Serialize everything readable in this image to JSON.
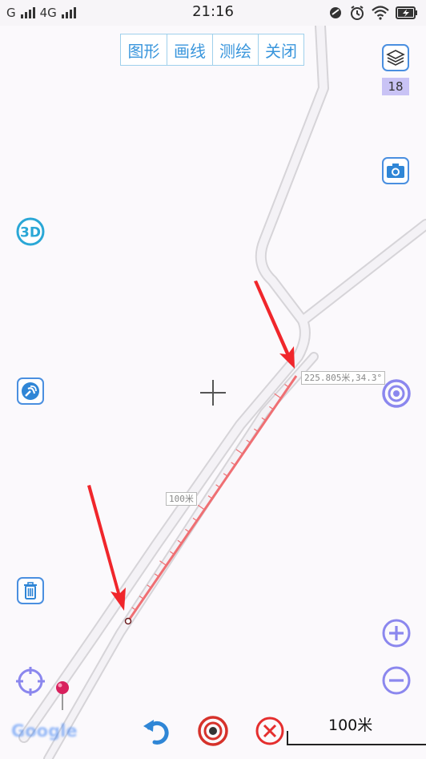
{
  "status_bar": {
    "carrier1": "G",
    "carrier2": "4G",
    "time": "21:16",
    "icons": [
      "dnd-icon",
      "alarm-icon",
      "wifi-icon",
      "battery-charging-icon"
    ]
  },
  "toolbar": {
    "items": [
      "图形",
      "画线",
      "测绘",
      "关闭"
    ]
  },
  "right_panel": {
    "layers_icon": "layers-icon",
    "zoom_level": "18",
    "camera_icon": "camera-icon",
    "locate_target_icon": "target-icon",
    "zoom_in_icon": "zoom-in-icon",
    "zoom_out_icon": "zoom-out-icon"
  },
  "left_panel": {
    "threed_label": "3D",
    "satellite_icon": "satellite-icon",
    "trash_icon": "trash-icon",
    "gps_icon": "gps-crosshair-icon"
  },
  "measurement": {
    "end_label": "225.805米,34.3°",
    "mid_label": "100米"
  },
  "bottom_bar": {
    "undo_icon": "undo-icon",
    "record_icon": "record-icon",
    "clear_icon": "clear-icon",
    "scale_label": "100米"
  },
  "attribution": {
    "google": "Google"
  },
  "colors": {
    "accent_blue": "#3a96dc",
    "icon_purple": "#8b87ee",
    "measure_line": "#ef6f73",
    "arrow_red": "#f0262b",
    "road_outline": "#d6d4d8"
  }
}
